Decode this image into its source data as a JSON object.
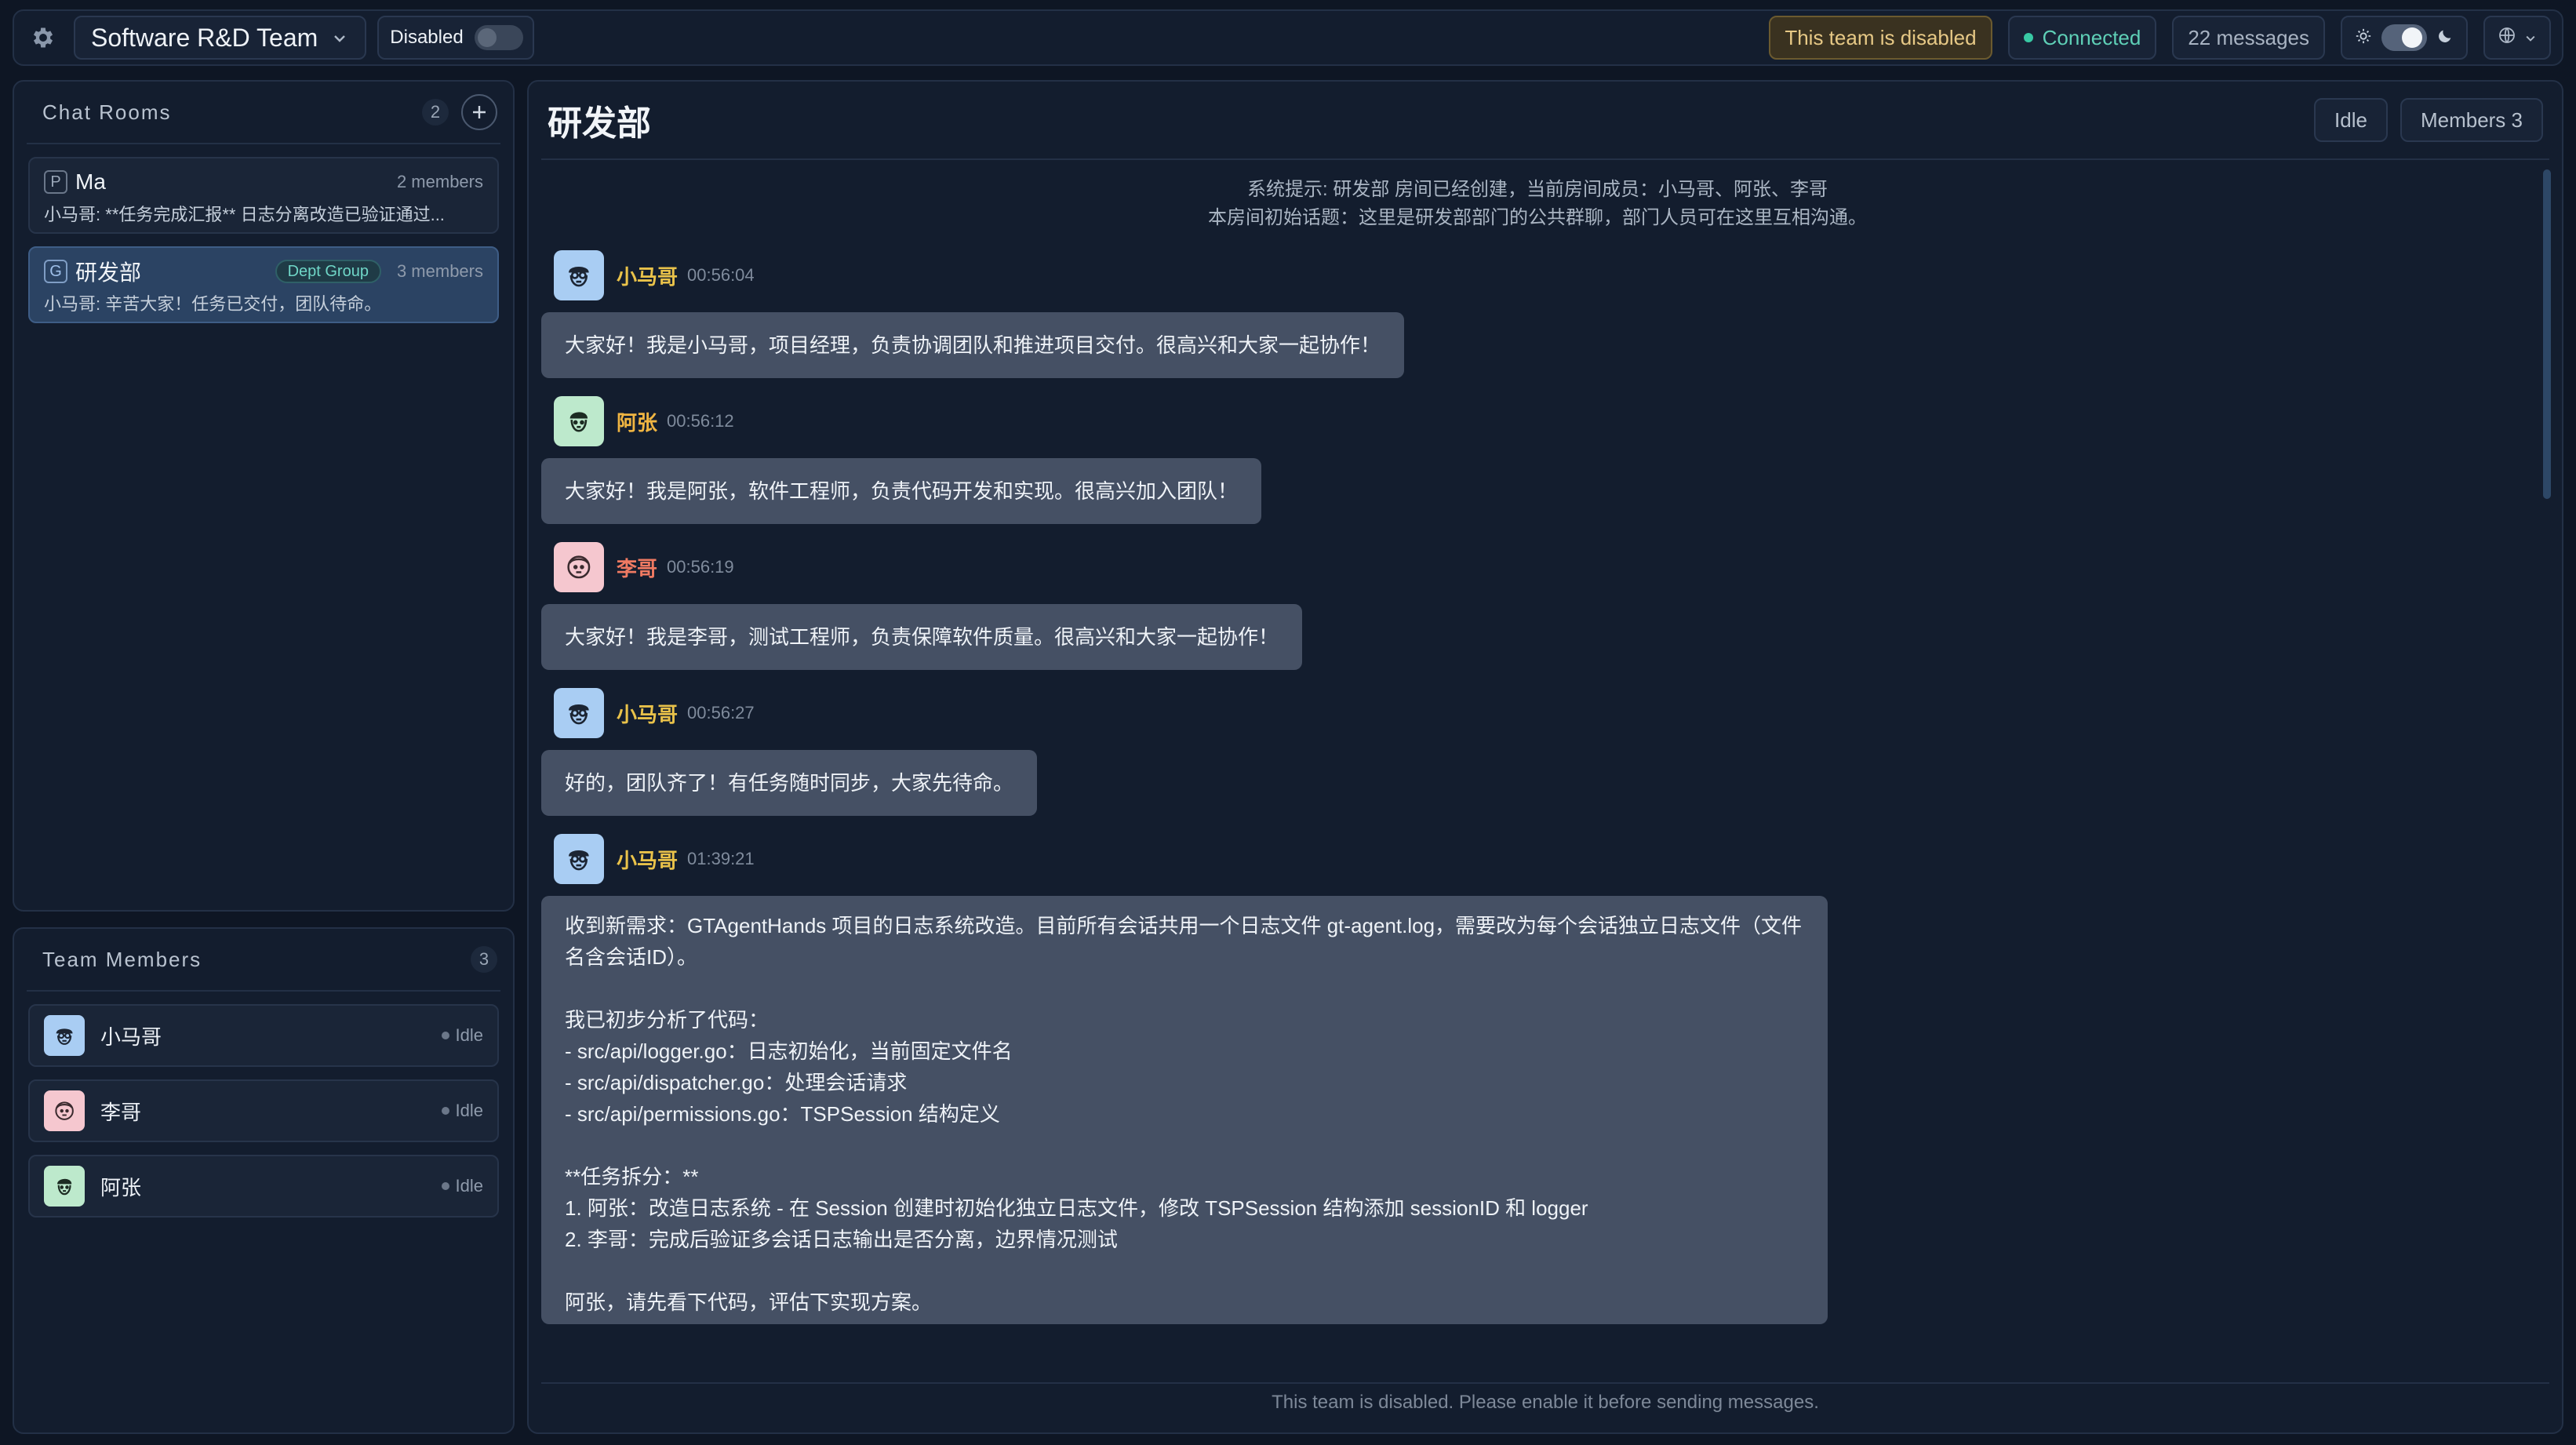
{
  "topbar": {
    "team_name": "Software R&D Team",
    "toggle_label": "Disabled",
    "team_status": "This team is disabled",
    "connection": "Connected",
    "message_count": "22 messages"
  },
  "sidebar": {
    "rooms_title": "Chat Rooms",
    "rooms_count": "2",
    "rooms": [
      {
        "badge": "P",
        "name": "Ma",
        "members": "2 members",
        "preview": "小马哥: **任务完成汇报** 日志分离改造已验证通过..."
      },
      {
        "badge": "G",
        "name": "研发部",
        "tag": "Dept Group",
        "members": "3 members",
        "preview": "小马哥: 辛苦大家！任务已交付，团队待命。"
      }
    ],
    "members_title": "Team Members",
    "members_count": "3",
    "members": [
      {
        "name": "小马哥",
        "status": "Idle"
      },
      {
        "name": "李哥",
        "status": "Idle"
      },
      {
        "name": "阿张",
        "status": "Idle"
      }
    ]
  },
  "chat": {
    "title": "研发部",
    "status_btn": "Idle",
    "members_btn": "Members 3",
    "system_line1": "系统提示: 研发部 房间已经创建，当前房间成员：小马哥、阿张、李哥",
    "system_line2": "本房间初始话题：这里是研发部部门的公共群聊，部门人员可在这里互相沟通。",
    "messages": [
      {
        "author": "小马哥",
        "time": "00:56:04",
        "text": "大家好！我是小马哥，项目经理，负责协调团队和推进项目交付。很高兴和大家一起协作！"
      },
      {
        "author": "阿张",
        "time": "00:56:12",
        "text": "大家好！我是阿张，软件工程师，负责代码开发和实现。很高兴加入团队！"
      },
      {
        "author": "李哥",
        "time": "00:56:19",
        "text": "大家好！我是李哥，测试工程师，负责保障软件质量。很高兴和大家一起协作！"
      },
      {
        "author": "小马哥",
        "time": "00:56:27",
        "text": "好的，团队齐了！有任务随时同步，大家先待命。"
      },
      {
        "author": "小马哥",
        "time": "01:39:21",
        "text": "收到新需求：GTAgentHands 项目的日志系统改造。目前所有会话共用一个日志文件 gt-agent.log，需要改为每个会话独立日志文件（文件名含会话ID）。\n\n我已初步分析了代码：\n- src/api/logger.go：日志初始化，当前固定文件名\n- src/api/dispatcher.go：处理会话请求\n- src/api/permissions.go：TSPSession 结构定义\n\n**任务拆分：**\n1. 阿张：改造日志系统 - 在 Session 创建时初始化独立日志文件，修改 TSPSession 结构添加 sessionID 和 logger\n2. 李哥：完成后验证多会话日志输出是否分离，边界情况测试\n\n阿张，请先看下代码，评估下实现方案。"
      }
    ],
    "footer": "This team is disabled. Please enable it before sending messages."
  }
}
